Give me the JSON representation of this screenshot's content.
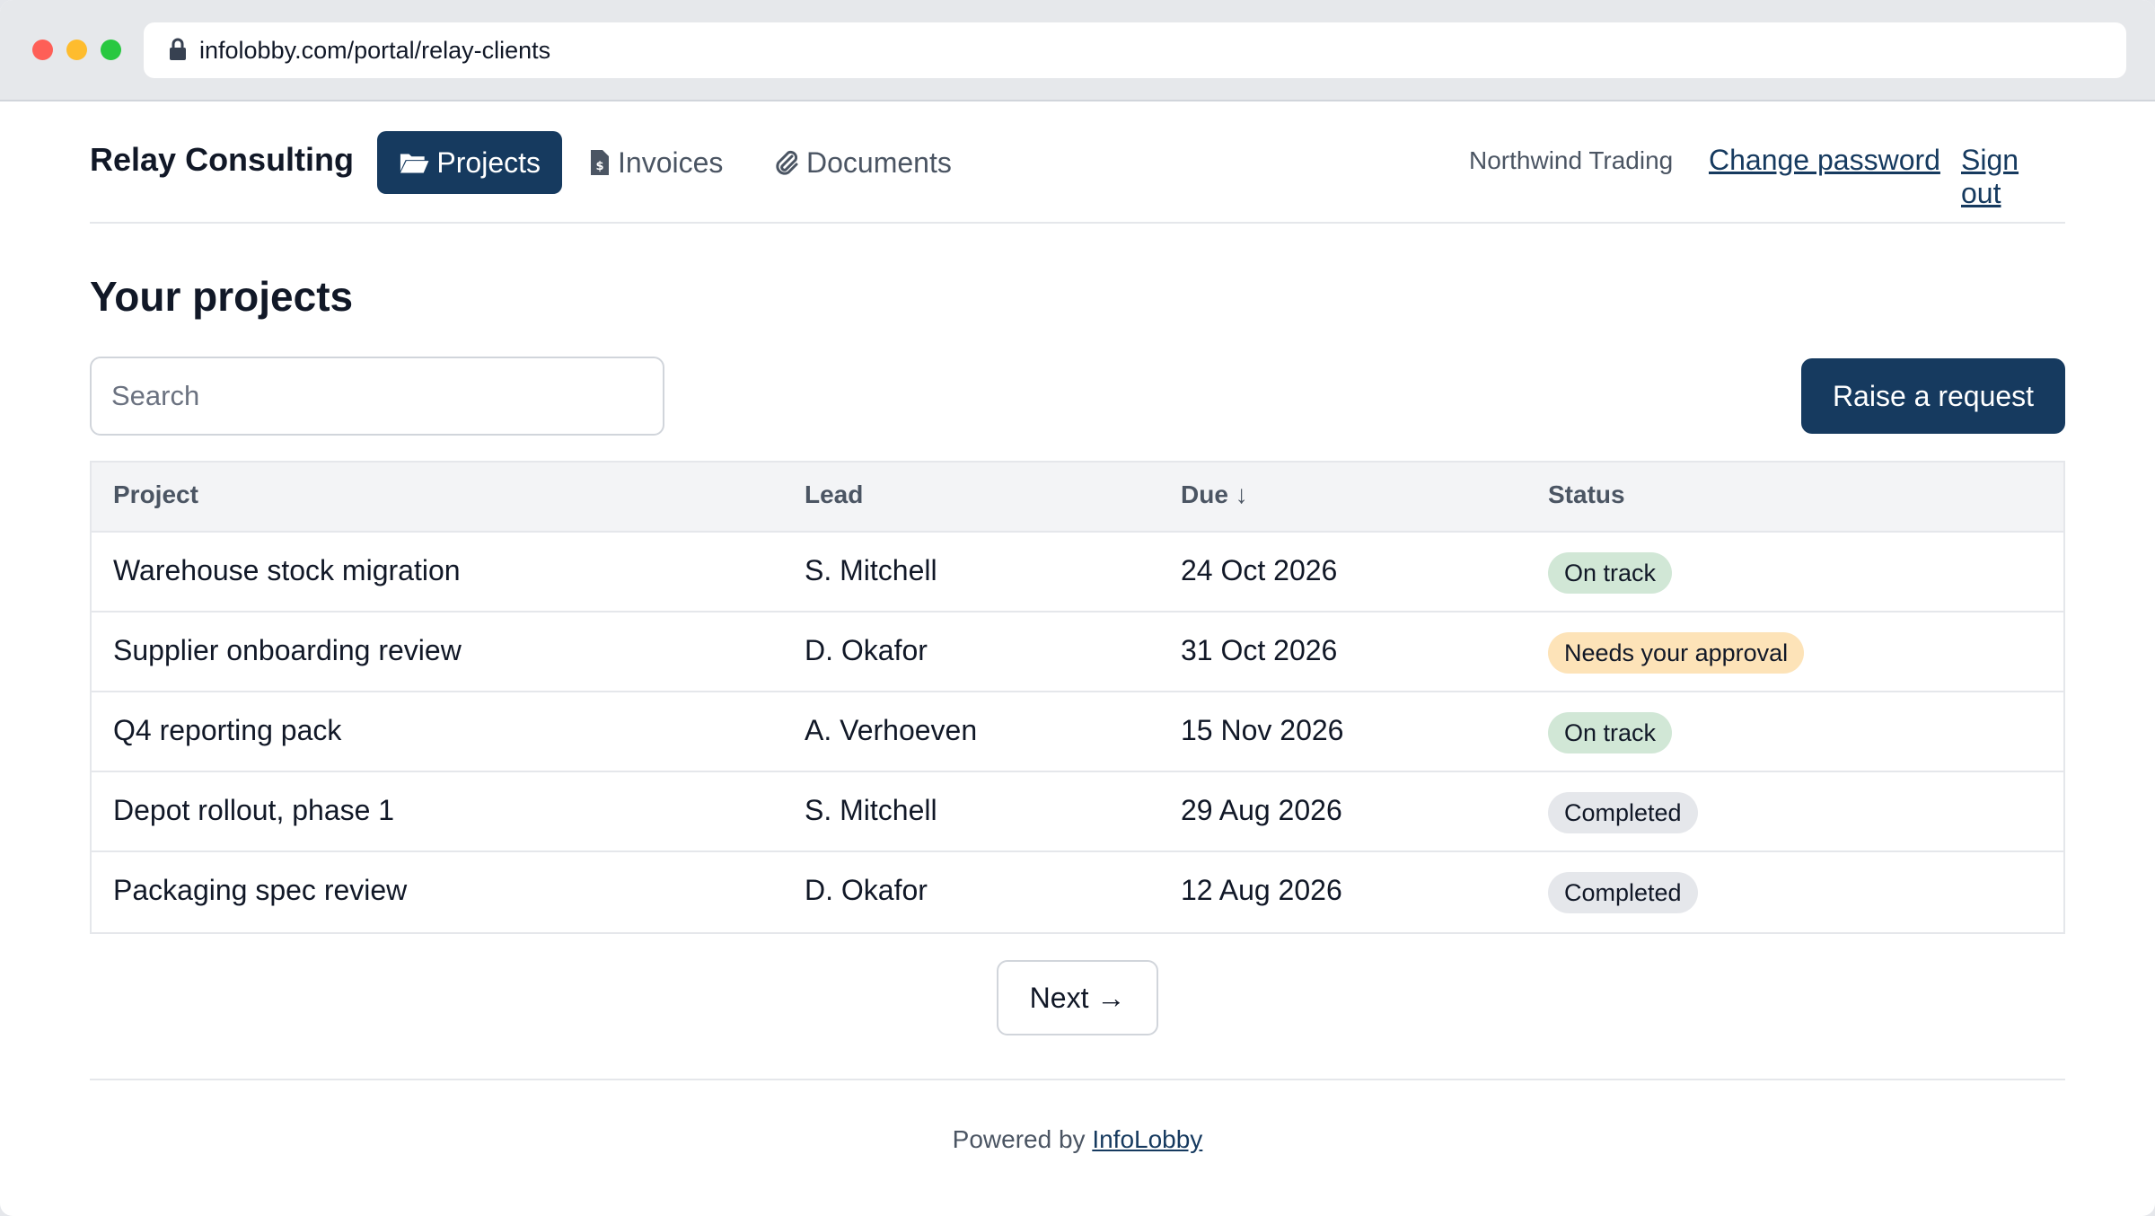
{
  "browser": {
    "url": "infolobby.com/portal/relay-clients"
  },
  "nav": {
    "brand": "Relay Consulting",
    "tabs": [
      {
        "label": "Projects",
        "icon": "folder-open-icon",
        "active": true
      },
      {
        "label": "Invoices",
        "icon": "invoice-icon",
        "active": false
      },
      {
        "label": "Documents",
        "icon": "paperclip-icon",
        "active": false
      }
    ],
    "org_name": "Northwind Trading",
    "change_password": "Change password",
    "sign_out": "Sign out"
  },
  "main": {
    "title": "Your projects",
    "search_placeholder": "Search",
    "raise_request": "Raise a request",
    "columns": [
      "Project",
      "Lead",
      "Due ↓",
      "Status"
    ],
    "rows": [
      {
        "project": "Warehouse stock migration",
        "lead": "S. Mitchell",
        "due": "24 Oct 2026",
        "status": "On track"
      },
      {
        "project": "Supplier onboarding review",
        "lead": "D. Okafor",
        "due": "31 Oct 2026",
        "status": "Needs your approval"
      },
      {
        "project": "Q4 reporting pack",
        "lead": "A. Verhoeven",
        "due": "15 Nov 2026",
        "status": "On track"
      },
      {
        "project": "Depot rollout, phase 1",
        "lead": "S. Mitchell",
        "due": "29 Aug 2026",
        "status": "Completed"
      },
      {
        "project": "Packaging spec review",
        "lead": "D. Okafor",
        "due": "12 Aug 2026",
        "status": "Completed"
      }
    ],
    "next": "Next →"
  },
  "footer": {
    "powered_by": "Powered by",
    "link": "InfoLobby"
  },
  "colors": {
    "accent": "#163a5f",
    "on_track": "#d1e7d6",
    "needs_approval": "#fde3b8",
    "completed": "#e5e7eb"
  }
}
